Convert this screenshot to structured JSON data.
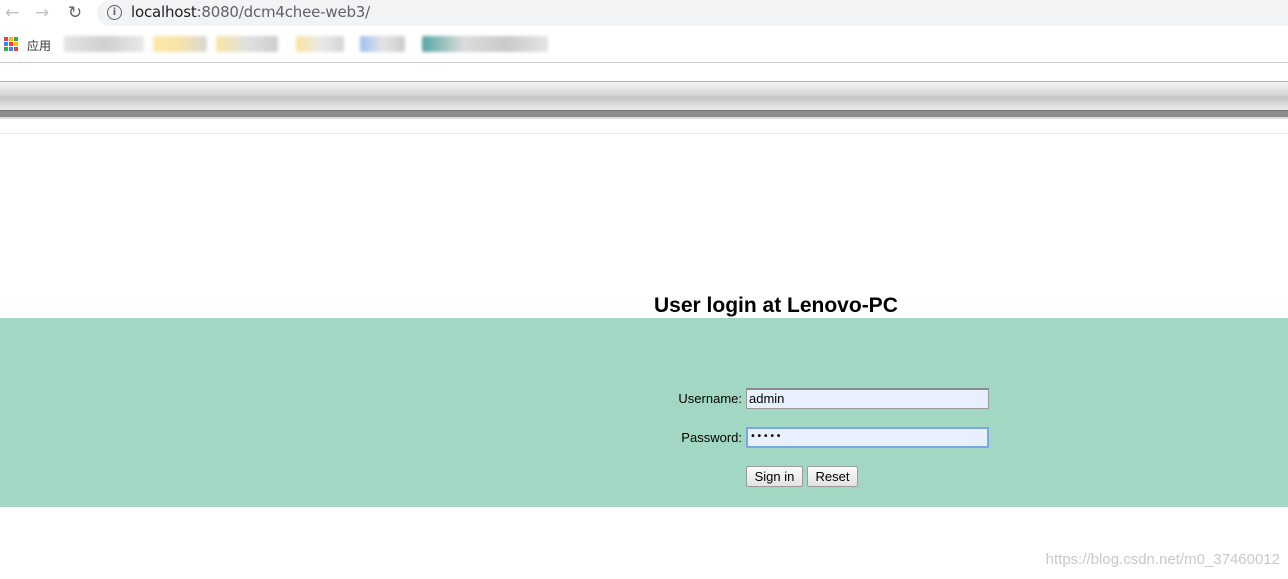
{
  "browser": {
    "url_host": "localhost",
    "url_rest": ":8080/dcm4chee-web3/",
    "bookmarks_apps_label": "应用"
  },
  "login": {
    "title": "User login at Lenovo-PC",
    "username_label": "Username:",
    "username_value": "admin",
    "password_label": "Password:",
    "password_mask": "•••••",
    "signin_label": "Sign in",
    "reset_label": "Reset"
  },
  "watermark": "https://blog.csdn.net/m0_37460012",
  "colors": {
    "login_band": "#a2d8c3",
    "field_bg": "#e8f0fe"
  },
  "icons": {
    "back": "←",
    "forward": "→",
    "reload": "↻",
    "info": "i"
  }
}
